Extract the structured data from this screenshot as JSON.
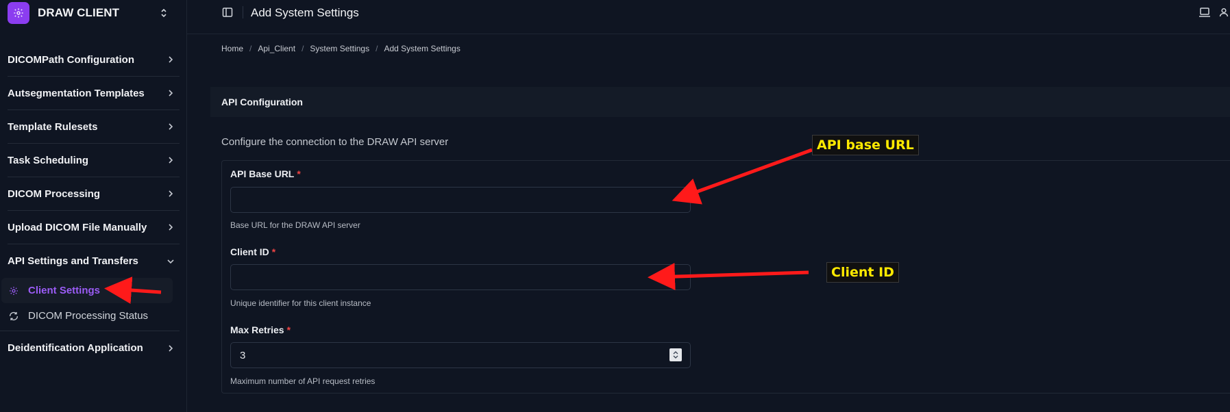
{
  "brand": {
    "name": "DRAW CLIENT",
    "logo_icon": "gear-icon",
    "accent": "#8b3df0"
  },
  "header": {
    "title": "Add System Settings"
  },
  "sidebar": {
    "items": [
      {
        "label": "DICOMPath Configuration"
      },
      {
        "label": "Autsegmentation Templates"
      },
      {
        "label": "Template Rulesets"
      },
      {
        "label": "Task Scheduling"
      },
      {
        "label": "DICOM Processing"
      },
      {
        "label": "Upload DICOM File Manually"
      },
      {
        "label": "API Settings and Transfers"
      },
      {
        "label": "Deidentification Application"
      }
    ],
    "subitems": [
      {
        "label": "Client Settings",
        "icon": "gear-icon",
        "active": true
      },
      {
        "label": "DICOM Processing Status",
        "icon": "refresh-icon",
        "active": false
      }
    ]
  },
  "breadcrumb": [
    "Home",
    "Api_Client",
    "System Settings",
    "Add System Settings"
  ],
  "section": {
    "title": "API Configuration",
    "description": "Configure the connection to the DRAW API server"
  },
  "form": {
    "api_base_url": {
      "label": "API Base URL",
      "required": "*",
      "value": "",
      "help": "Base URL for the DRAW API server"
    },
    "client_id": {
      "label": "Client ID",
      "required": "*",
      "value": "",
      "help": "Unique identifier for this client instance"
    },
    "max_retries": {
      "label": "Max Retries",
      "required": "*",
      "value": "3",
      "help": "Maximum number of API request retries"
    }
  },
  "annotations": {
    "api_base_url": "API base URL",
    "client_id": "Client ID",
    "arrow_color": "#ff1a1a",
    "callout_text_color": "#ffea00"
  }
}
